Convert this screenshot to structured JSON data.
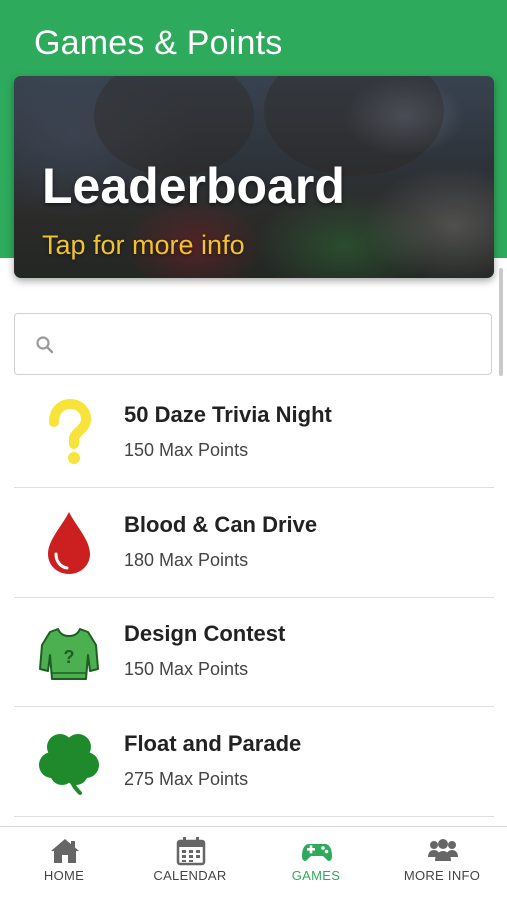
{
  "header": {
    "title": "Games & Points"
  },
  "banner": {
    "title": "Leaderboard",
    "subtitle": "Tap for more info"
  },
  "search": {
    "placeholder": ""
  },
  "games": [
    {
      "title": "50 Daze Trivia Night",
      "points": "150 Max Points",
      "icon": "question-mark-icon"
    },
    {
      "title": "Blood & Can Drive",
      "points": "180 Max Points",
      "icon": "blood-drop-icon"
    },
    {
      "title": "Design Contest",
      "points": "150 Max Points",
      "icon": "sweater-icon"
    },
    {
      "title": "Float and Parade",
      "points": "275 Max Points",
      "icon": "shamrock-icon"
    }
  ],
  "tabs": [
    {
      "label": "HOME",
      "icon": "home-icon",
      "active": false
    },
    {
      "label": "CALENDAR",
      "icon": "calendar-icon",
      "active": false
    },
    {
      "label": "GAMES",
      "icon": "gamepad-icon",
      "active": true
    },
    {
      "label": "MORE INFO",
      "icon": "people-icon",
      "active": false
    }
  ],
  "colors": {
    "brand": "#2eaa5c",
    "accent_yellow": "#f2c230",
    "blood_red": "#cc1f1f",
    "icon_gray": "#666666"
  }
}
